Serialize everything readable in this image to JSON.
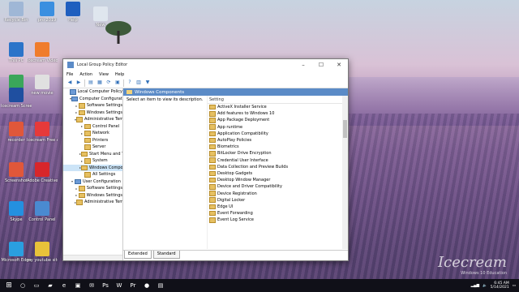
{
  "desktop": {
    "icons": [
      {
        "label": "Recycle Bin",
        "color": "#9fb7d6"
      },
      {
        "label": "pro 2019",
        "color": "#3a8fe0"
      },
      {
        "label": "Help",
        "color": "#1f5fbf"
      },
      {
        "label": "New",
        "color": "#dfe6ee"
      },
      {
        "label": "This PC",
        "color": "#2c74c9"
      },
      {
        "label": "Icecream Video Editor",
        "color": "#f07c2c"
      },
      {
        "label": "Screen",
        "color": "#3aa65a"
      },
      {
        "label": "Icecream Screen",
        "color": "#1f4fa0"
      },
      {
        "label": "new movie",
        "color": "#e0e0e0"
      },
      {
        "label": "recorder",
        "color": "#e0573a"
      },
      {
        "label": "Icecream Free Analytics",
        "color": "#e63a3a"
      },
      {
        "label": "Screenshot",
        "color": "#e0573a"
      },
      {
        "label": "Adobe Creative Cloud",
        "color": "#d8262b"
      },
      {
        "label": "Skype",
        "color": "#2490e0"
      },
      {
        "label": "Control Panel",
        "color": "#4a8ad0"
      },
      {
        "label": "Microsoft Edge",
        "color": "#2a9fe0"
      },
      {
        "label": "my youtube site video 1 video",
        "color": "#e8c23a"
      }
    ]
  },
  "window": {
    "title": "Local Group Policy Editor",
    "buttons": {
      "minimize": "–",
      "maximize": "☐",
      "close": "✕"
    },
    "menu": [
      "File",
      "Action",
      "View",
      "Help"
    ],
    "toolbar_icons": [
      "back-arrow-icon",
      "forward-arrow-icon",
      "up-folder-icon",
      "show-hide-tree-icon",
      "refresh-icon",
      "export-list-icon",
      "help-icon",
      "properties-icon",
      "filter-icon"
    ],
    "tree": [
      {
        "label": "Local Computer Policy",
        "indent": 0,
        "exp": "",
        "type": "pc"
      },
      {
        "label": "Computer Configuration",
        "indent": 1,
        "exp": "v",
        "type": "pc"
      },
      {
        "label": "Software Settings",
        "indent": 2,
        "exp": ">",
        "type": "folder"
      },
      {
        "label": "Windows Settings",
        "indent": 2,
        "exp": ">",
        "type": "folder"
      },
      {
        "label": "Administrative Templates",
        "indent": 2,
        "exp": "v",
        "type": "folder"
      },
      {
        "label": "Control Panel",
        "indent": 3,
        "exp": ">",
        "type": "folder"
      },
      {
        "label": "Network",
        "indent": 3,
        "exp": ">",
        "type": "folder"
      },
      {
        "label": "Printers",
        "indent": 3,
        "exp": "",
        "type": "folder"
      },
      {
        "label": "Server",
        "indent": 3,
        "exp": "",
        "type": "folder"
      },
      {
        "label": "Start Menu and Taskbar",
        "indent": 3,
        "exp": ">",
        "type": "folder"
      },
      {
        "label": "System",
        "indent": 3,
        "exp": ">",
        "type": "folder"
      },
      {
        "label": "Windows Components",
        "indent": 3,
        "exp": ">",
        "type": "folder",
        "selected": true
      },
      {
        "label": "All Settings",
        "indent": 3,
        "exp": "",
        "type": "folder"
      },
      {
        "label": "User Configuration",
        "indent": 1,
        "exp": "v",
        "type": "pc"
      },
      {
        "label": "Software Settings",
        "indent": 2,
        "exp": ">",
        "type": "folder"
      },
      {
        "label": "Windows Settings",
        "indent": 2,
        "exp": ">",
        "type": "folder"
      },
      {
        "label": "Administrative Templates",
        "indent": 2,
        "exp": ">",
        "type": "folder"
      }
    ],
    "header_title": "Windows Components",
    "description": "Select an item to view its description.",
    "list_column": "Setting",
    "settings": [
      "ActiveX Installer Service",
      "Add features to Windows 10",
      "App Package Deployment",
      "App runtime",
      "Application Compatibility",
      "AutoPlay Policies",
      "Biometrics",
      "BitLocker Drive Encryption",
      "Credential User Interface",
      "Data Collection and Preview Builds",
      "Desktop Gadgets",
      "Desktop Window Manager",
      "Device and Driver Compatibility",
      "Device Registration",
      "Digital Locker",
      "Edge UI",
      "Event Forwarding",
      "Event Log Service"
    ],
    "tabs": [
      "Extended",
      "Standard"
    ]
  },
  "taskbar": {
    "apps": [
      "start-icon",
      "search-icon",
      "task-view-icon",
      "file-explorer-icon",
      "edge-icon",
      "store-icon",
      "mail-icon",
      "photoshop-icon",
      "word-icon",
      "premiere-icon",
      "recorder-icon",
      "policy-icon"
    ],
    "time": "6:45 AM",
    "date": "5/14/2021"
  },
  "watermark": {
    "brand": "Icecream",
    "sub": "Windows 10 Education"
  }
}
